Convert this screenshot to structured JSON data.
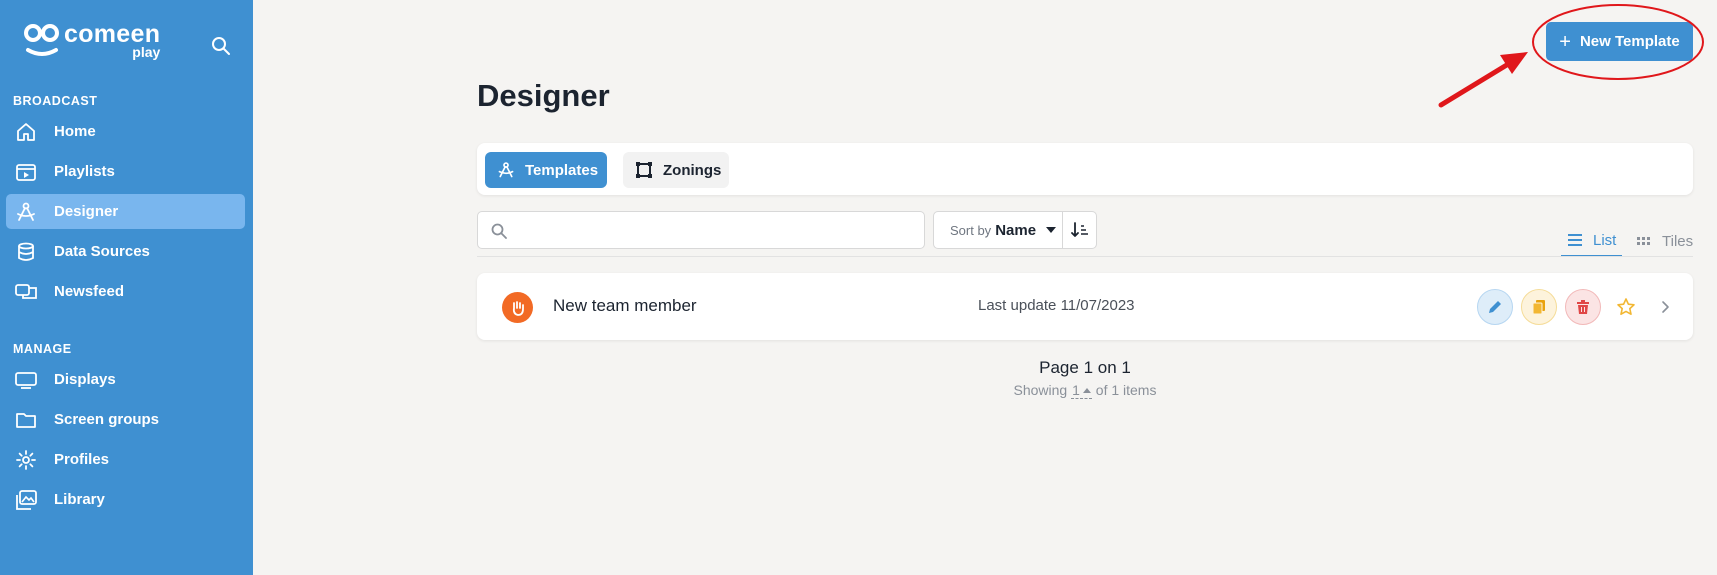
{
  "brand": {
    "name": "comeen",
    "sub": "play"
  },
  "sidebar": {
    "sections": [
      {
        "title": "BROADCAST"
      },
      {
        "title": "MANAGE"
      }
    ],
    "items": [
      {
        "label": "Home",
        "icon": "home-icon"
      },
      {
        "label": "Playlists",
        "icon": "playlist-icon"
      },
      {
        "label": "Designer",
        "icon": "designer-icon",
        "active": true
      },
      {
        "label": "Data Sources",
        "icon": "database-icon"
      },
      {
        "label": "Newsfeed",
        "icon": "newsfeed-icon"
      },
      {
        "label": "Displays",
        "icon": "monitor-icon"
      },
      {
        "label": "Screen groups",
        "icon": "folder-icon"
      },
      {
        "label": "Profiles",
        "icon": "gear-icon"
      },
      {
        "label": "Library",
        "icon": "library-icon"
      }
    ]
  },
  "header": {
    "new_button_label": "New Template",
    "title": "Designer"
  },
  "tabs": [
    {
      "label": "Templates",
      "active": true
    },
    {
      "label": "Zonings",
      "active": false
    }
  ],
  "toolbar": {
    "search_placeholder": "",
    "search_value": "",
    "sort_label": "Sort by",
    "sort_value": "Name",
    "view_list_label": "List",
    "view_tiles_label": "Tiles"
  },
  "rows": [
    {
      "name": "New team member",
      "last_update": "Last update 11/07/2023"
    }
  ],
  "pagination": {
    "page_text": "Page 1 on 1",
    "showing_prefix": "Showing",
    "per_page": "1",
    "showing_suffix": "of 1 items"
  },
  "colors": {
    "accent": "#3f90d1",
    "sidebar_active": "#79b6ee",
    "row_icon": "#f26a25",
    "annotation": "#e0171b"
  }
}
